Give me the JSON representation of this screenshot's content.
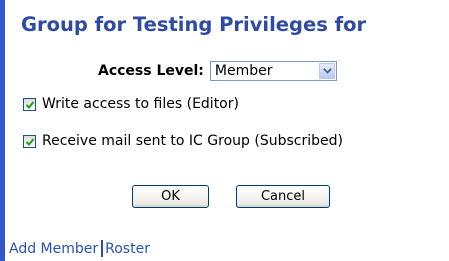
{
  "header": {
    "title": "Group for Testing Privileges for"
  },
  "access": {
    "label": "Access Level:",
    "selected": "Member"
  },
  "options": [
    {
      "label": "Write access to files (Editor)",
      "checked": true
    },
    {
      "label": "Receive mail sent to IC Group (Subscribed)",
      "checked": true
    }
  ],
  "buttons": {
    "ok": "OK",
    "cancel": "Cancel"
  },
  "links": {
    "add_member": "Add Member",
    "roster": "Roster"
  },
  "colors": {
    "accent": "#2f4aa3",
    "link": "#2952b8",
    "left_bar": "#3355cc"
  },
  "icons": {
    "dropdown": "chevron-down-icon",
    "check": "checkmark-icon"
  }
}
